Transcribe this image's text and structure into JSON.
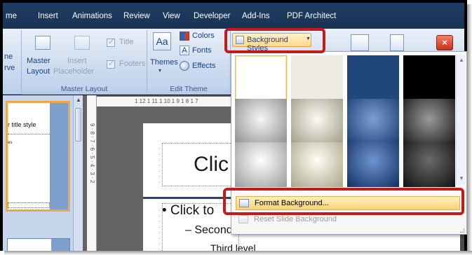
{
  "tabs": [
    "me",
    "Insert",
    "Animations",
    "Review",
    "View",
    "Developer",
    "Add-Ins",
    "PDF Architect"
  ],
  "ribbon": {
    "master_layout_group": {
      "name": "Master Layout",
      "partial_label_1": "ne",
      "partial_label_2": "rve",
      "master_layout_line1": "Master",
      "master_layout_line2": "Layout",
      "insert_placeholder_line1": "Insert",
      "insert_placeholder_line2": "Placeholder",
      "title_label": "Title",
      "footers_label": "Footers"
    },
    "edit_theme_group": {
      "name": "Edit Theme",
      "themes_label": "Themes",
      "colors_label": "Colors",
      "fonts_label": "Fonts",
      "effects_label": "Effects"
    },
    "background_styles_label": "Background Styles",
    "close_label": "×"
  },
  "gallery": {
    "swatch_colors": [
      [
        "#ffffff",
        "#eeece2",
        "#20477a",
        "#000000"
      ],
      [
        "radial-gradient(circle at 50% 45%, #f6f6f6, #8e8e8e)",
        "radial-gradient(circle at 50% 45%, #fbfaf3, #9f9c86)",
        "radial-gradient(circle at 50% 45%, #7e9fd2, #1a3c74)",
        "radial-gradient(circle at 50% 45%, #9a9a9a, #1b1b1b)"
      ],
      [
        "radial-gradient(circle at 50% 40%, #ffffff, #9a9a9a)",
        "radial-gradient(circle at 50% 40%, #fffef4, #a8a48a)",
        "radial-gradient(circle at 50% 40%, #6f94d0, #112f63)",
        "radial-gradient(circle at 50% 40%, #6a6a6a, #111111)"
      ]
    ],
    "menu": {
      "format_background": "Format Background...",
      "reset_slide_background": "Reset Slide Background"
    }
  },
  "thumbnail": {
    "title_text": "r title style",
    "sub_text": "es"
  },
  "ruler": {
    "horizontal_text": "1 12 1 11 1 10 1 9 1 8 1 7",
    "vertical_text": "9 · 8 · 7 · 6 · 5 · 4 · 3 · 2"
  },
  "slide": {
    "title_text": "Clic",
    "bullet_1": "• Click to",
    "bullet_2": "– Second level",
    "bullet_3": "Third level"
  }
}
